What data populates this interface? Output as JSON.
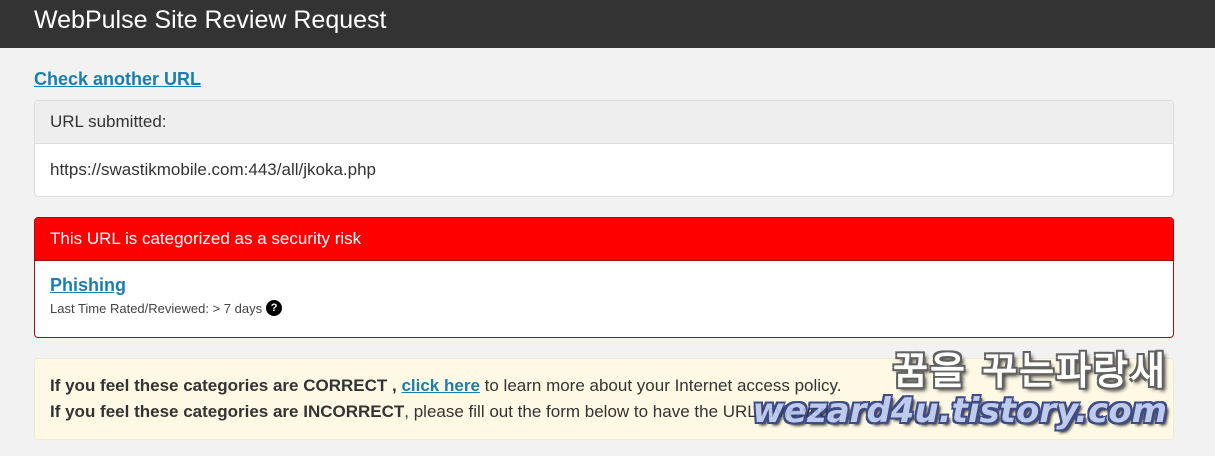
{
  "header": {
    "title": "WebPulse Site Review Request"
  },
  "check_link": "Check another URL",
  "submitted": {
    "label": "URL submitted:",
    "url": "https://swastikmobile.com:443/all/jkoka.php"
  },
  "result": {
    "banner": "This URL is categorized as a security risk",
    "category": "Phishing",
    "rated_text": "Last Time Rated/Reviewed: > 7 days",
    "help_glyph": "?",
    "banner_color": "#ff0000"
  },
  "notice": {
    "line1_bold": "If you feel these categories are CORRECT ,",
    "line1_link": "click here",
    "line1_rest": "to learn more about your Internet access policy.",
    "line2_bold": "If you feel these categories are INCORRECT",
    "line2_rest": ", please fill out the form below to have the URL reviewed."
  },
  "watermark": {
    "korean": "꿈을 꾸는파랑새",
    "url": "wezard4u.tistory.com"
  },
  "colors": {
    "link": "#1a7faa",
    "topbar": "#333333",
    "notice_bg": "#fdf9e5"
  }
}
